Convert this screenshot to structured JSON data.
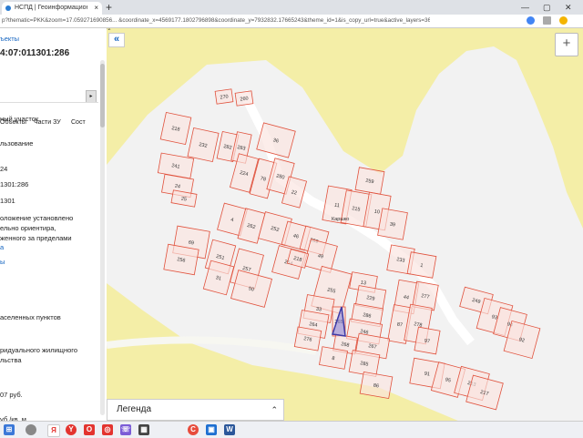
{
  "browser": {
    "tab_title": "НСПД | Геоинформационный",
    "tab_close": "×",
    "new_tab": "+",
    "url": "p?thematic=PKK&zoom=17.059271690856... &coordinate_x=4569177.1802796898&coordinate_y=7932832.17665243&theme_id=1&is_copy_url=true&active_layers=36048"
  },
  "panel": {
    "back_link": "ъекты",
    "cad_number": "4:07:011301:286",
    "tabs": [
      "Объекты",
      "Части ЗУ",
      "Сост"
    ],
    "lines": [
      "ный участок",
      "льзование",
      "24",
      "1301:286",
      "1301",
      "оложение установлено",
      "ельно ориентира,",
      "женного за пределами",
      "а",
      "ы",
      "аселенных пунктов",
      "ридуального жилищного",
      "льства",
      "07 руб.",
      "уб./кв. м"
    ]
  },
  "map": {
    "collapse_glyph": "«",
    "zoom_in": "+",
    "road_label": "Каршко",
    "parcels": [
      {
        "n": "270"
      },
      {
        "n": "260"
      },
      {
        "n": "218"
      },
      {
        "n": "232"
      },
      {
        "n": "282"
      },
      {
        "n": "283"
      },
      {
        "n": "36"
      },
      {
        "n": "241"
      },
      {
        "n": "24"
      },
      {
        "n": "25"
      },
      {
        "n": "224"
      },
      {
        "n": "78"
      },
      {
        "n": "280"
      },
      {
        "n": "22"
      },
      {
        "n": "259"
      },
      {
        "n": "11"
      },
      {
        "n": "215"
      },
      {
        "n": "10"
      },
      {
        "n": "39"
      },
      {
        "n": "4"
      },
      {
        "n": "262"
      },
      {
        "n": "252"
      },
      {
        "n": "46"
      },
      {
        "n": "269"
      },
      {
        "n": "49"
      },
      {
        "n": "69"
      },
      {
        "n": "256"
      },
      {
        "n": "251"
      },
      {
        "n": "31"
      },
      {
        "n": "257"
      },
      {
        "n": "254"
      },
      {
        "n": "218"
      },
      {
        "n": "50"
      },
      {
        "n": "255"
      },
      {
        "n": "13"
      },
      {
        "n": "233"
      },
      {
        "n": "1"
      },
      {
        "n": "229"
      },
      {
        "n": "44"
      },
      {
        "n": "277"
      },
      {
        "n": "33"
      },
      {
        "n": "264"
      },
      {
        "n": "265"
      },
      {
        "n": "286"
      },
      {
        "n": "87"
      },
      {
        "n": "278"
      },
      {
        "n": "276"
      },
      {
        "n": "246"
      },
      {
        "n": "268"
      },
      {
        "n": "267"
      },
      {
        "n": "97"
      },
      {
        "n": "8"
      },
      {
        "n": "285"
      },
      {
        "n": "86"
      },
      {
        "n": "91"
      },
      {
        "n": "249"
      },
      {
        "n": "93"
      },
      {
        "n": "94"
      },
      {
        "n": "92"
      },
      {
        "n": "95"
      },
      {
        "n": "213"
      },
      {
        "n": "217"
      },
      {
        "n": "272"
      }
    ]
  },
  "legend": {
    "label": "Легенда",
    "chevron": "⌃⌄"
  },
  "taskbar": {
    "items": [
      "windows-logo",
      "search",
      "yandex-browser",
      "opera",
      "chrome-like",
      "apps",
      "viber",
      "store",
      "c-app",
      "photos",
      "word"
    ]
  }
}
